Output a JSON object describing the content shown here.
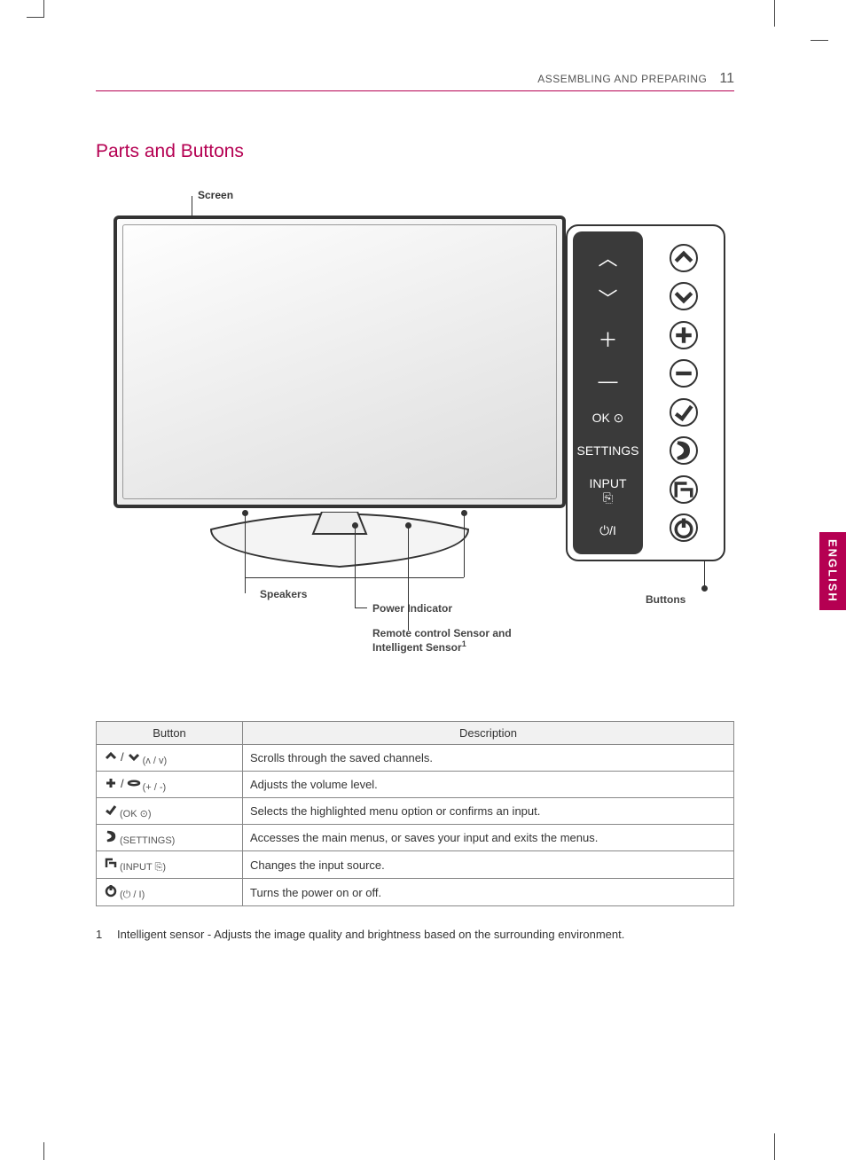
{
  "header": {
    "section": "ASSEMBLING AND PREPARING",
    "page_number": "11"
  },
  "title": "Parts and Buttons",
  "diagram_labels": {
    "screen": "Screen",
    "speakers": "Speakers",
    "power_indicator": "Power Indicator",
    "remote_sensor": "Remote control Sensor and Intelligent Sensor",
    "remote_sensor_sup": "1",
    "buttons": "Buttons"
  },
  "panel": {
    "left": [
      "︿",
      "﹀",
      "＋",
      "—",
      "OK ⊙",
      "SETTINGS",
      "INPUT\n⎘",
      "⏻/I"
    ],
    "right_icons": [
      "up",
      "down",
      "plus",
      "minus",
      "ok",
      "settings",
      "input",
      "power"
    ]
  },
  "table": {
    "headers": {
      "button": "Button",
      "description": "Description"
    },
    "rows": [
      {
        "button_sym": "updown",
        "button_text": "(ʌ / v)",
        "desc": "Scrolls through the saved channels."
      },
      {
        "button_sym": "plusminus",
        "button_text": "(+ / -)",
        "desc": "Adjusts the volume level."
      },
      {
        "button_sym": "ok",
        "button_text": "(OK ⊙)",
        "desc": "Selects the highlighted menu option or confirms an input."
      },
      {
        "button_sym": "settings",
        "button_text": "(SETTINGS)",
        "desc": "Accesses the main menus, or saves your input and exits the menus."
      },
      {
        "button_sym": "input",
        "button_text": "(INPUT ⎘)",
        "desc": "Changes the input source."
      },
      {
        "button_sym": "power",
        "button_text": "(⏻ / I)",
        "desc": "Turns the power on or off."
      }
    ]
  },
  "footnote": {
    "num": "1",
    "text": "Intelligent sensor - Adjusts the image quality and brightness based on the surrounding environment."
  },
  "language_tab": "ENGLISH"
}
